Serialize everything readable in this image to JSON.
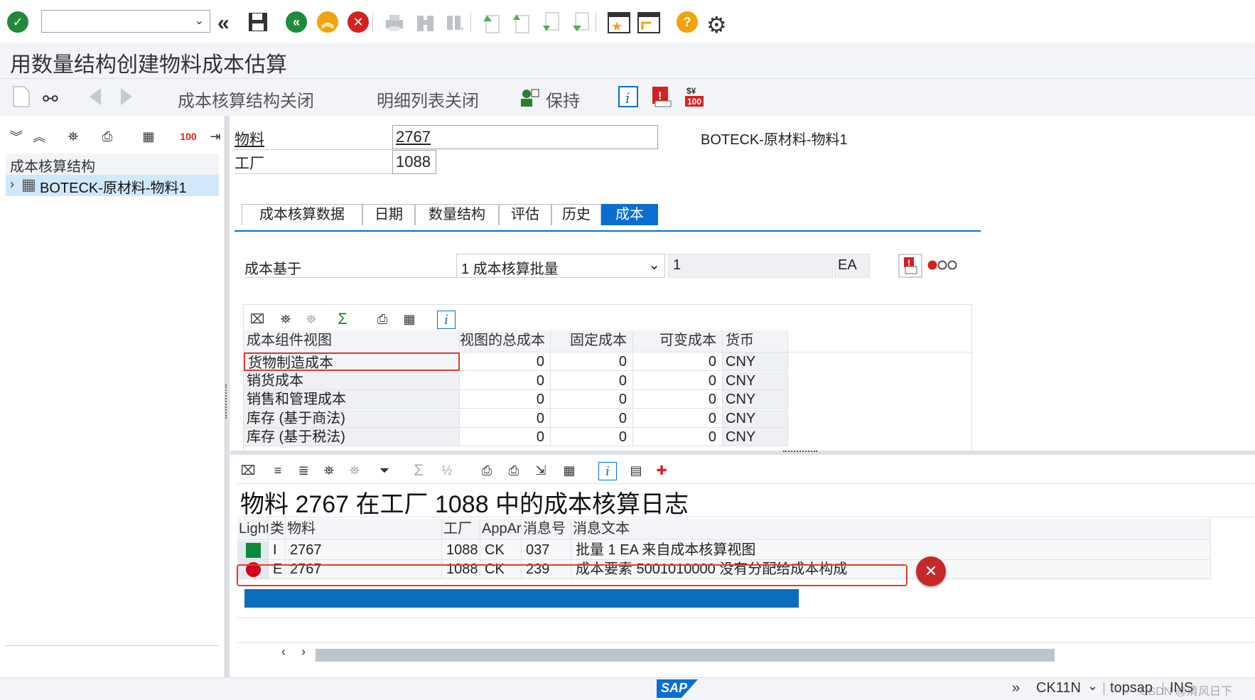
{
  "toolbar": {
    "command_field_value": "",
    "icons": [
      "check-icon",
      "back-double-icon",
      "save-icon",
      "back-icon",
      "exit-icon",
      "cancel-icon",
      "print-icon",
      "find-icon",
      "find-next-icon",
      "first-page-icon",
      "prev-page-icon",
      "next-page-icon",
      "last-page-icon",
      "new-window-icon",
      "shortcut-icon",
      "help-icon",
      "settings-icon"
    ]
  },
  "title": "用数量结构创建物料成本估算",
  "app_toolbar": {
    "costing_structure_off": "成本核算结构关闭",
    "itemization_off": "明细列表关闭",
    "keep": "保持"
  },
  "tree": {
    "header": "成本核算结构",
    "item": "BOTECK-原材料-物料1"
  },
  "header_fields": {
    "material_label": "物料",
    "material_value": "2767",
    "material_desc": "BOTECK-原材料-物料1",
    "plant_label": "工厂",
    "plant_value": "1088"
  },
  "tabs": [
    "成本核算数据",
    "日期",
    "数量结构",
    "评估",
    "历史",
    "成本"
  ],
  "cost_base": {
    "label": "成本基于",
    "select_value": "1 成本核算批量",
    "qty": "1",
    "unit": "EA"
  },
  "cost_table": {
    "headers": [
      "成本组件视图",
      "视图的总成本",
      "固定成本",
      "可变成本",
      "货币"
    ],
    "rows": [
      [
        "货物制造成本",
        "0",
        "0",
        "0",
        "CNY"
      ],
      [
        "销货成本",
        "0",
        "0",
        "0",
        "CNY"
      ],
      [
        "销售和管理成本",
        "0",
        "0",
        "0",
        "CNY"
      ],
      [
        "库存 (基于商法)",
        "0",
        "0",
        "0",
        "CNY"
      ],
      [
        "库存 (基于税法)",
        "0",
        "0",
        "0",
        "CNY"
      ]
    ]
  },
  "log": {
    "title": "物料 2767 在工厂 1088 中的成本核算日志",
    "headers": [
      "Light",
      "类",
      "物料",
      "工厂",
      "AppAr",
      "消息号",
      "消息文本"
    ],
    "rows": [
      {
        "light": "green",
        "type": "I",
        "material": "2767",
        "plant": "1088",
        "appar": "CK",
        "msgno": "037",
        "text": "批量 1 EA 来自成本核算视图"
      },
      {
        "light": "red",
        "type": "E",
        "material": "2767",
        "plant": "1088",
        "appar": "CK",
        "msgno": "239",
        "text": "成本要素 5001010000 没有分配给成本构成"
      }
    ]
  },
  "status": {
    "logo": "SAP",
    "tcode": "CK11N",
    "server": "topsap",
    "mode": "INS",
    "chevron": "»",
    "watermark": "CSDN @清风日下"
  },
  "colors": {
    "green": "#0a8a3a",
    "red": "#d0021b",
    "active_tab": "#0a6ed1",
    "selection": "#0a6ebd"
  }
}
